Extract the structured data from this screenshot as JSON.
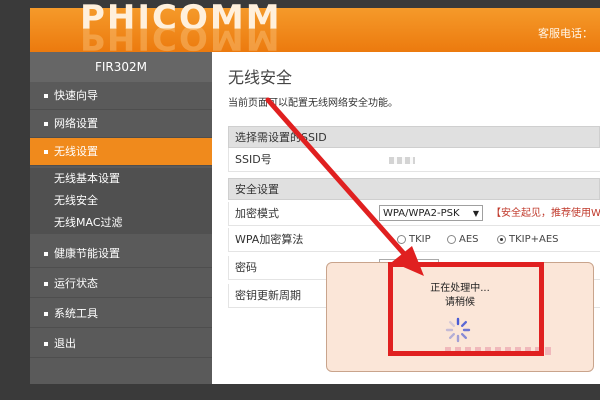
{
  "header": {
    "brand": "PHICOMM",
    "hotline_label": "客服电话："
  },
  "sidebar": {
    "model": "FIR302M",
    "items": [
      {
        "label": "快速向导"
      },
      {
        "label": "网络设置"
      },
      {
        "label": "无线设置",
        "active": true
      },
      {
        "label": "健康节能设置"
      },
      {
        "label": "运行状态"
      },
      {
        "label": "系统工具"
      },
      {
        "label": "退出"
      }
    ],
    "subitems": [
      {
        "label": "无线基本设置"
      },
      {
        "label": "无线安全"
      },
      {
        "label": "无线MAC过滤"
      }
    ]
  },
  "main": {
    "title": "无线安全",
    "description": "当前页面可以配置无线网络安全功能。",
    "ssid_section": {
      "heading": "选择需设置的SSID",
      "ssid_label": "SSID号"
    },
    "security_section": {
      "heading": "安全设置",
      "mode_label": "加密模式",
      "mode_value": "WPA/WPA2-PSK",
      "mode_warning": "【安全起见，推荐使用W",
      "algo_label": "WPA加密算法",
      "algo_options": [
        "TKIP",
        "AES",
        "TKIP+AES"
      ],
      "algo_selected": "TKIP+AES",
      "password_label": "密码",
      "renew_label": "密钥更新周期"
    }
  },
  "dialog": {
    "line1": "正在处理中...",
    "line2": "请稍候"
  },
  "colors": {
    "accent": "#f08a1c",
    "sidebar_bg": "#5a5a5a",
    "annotation_red": "#e02020",
    "dialog_bg": "#fbe6d8"
  }
}
